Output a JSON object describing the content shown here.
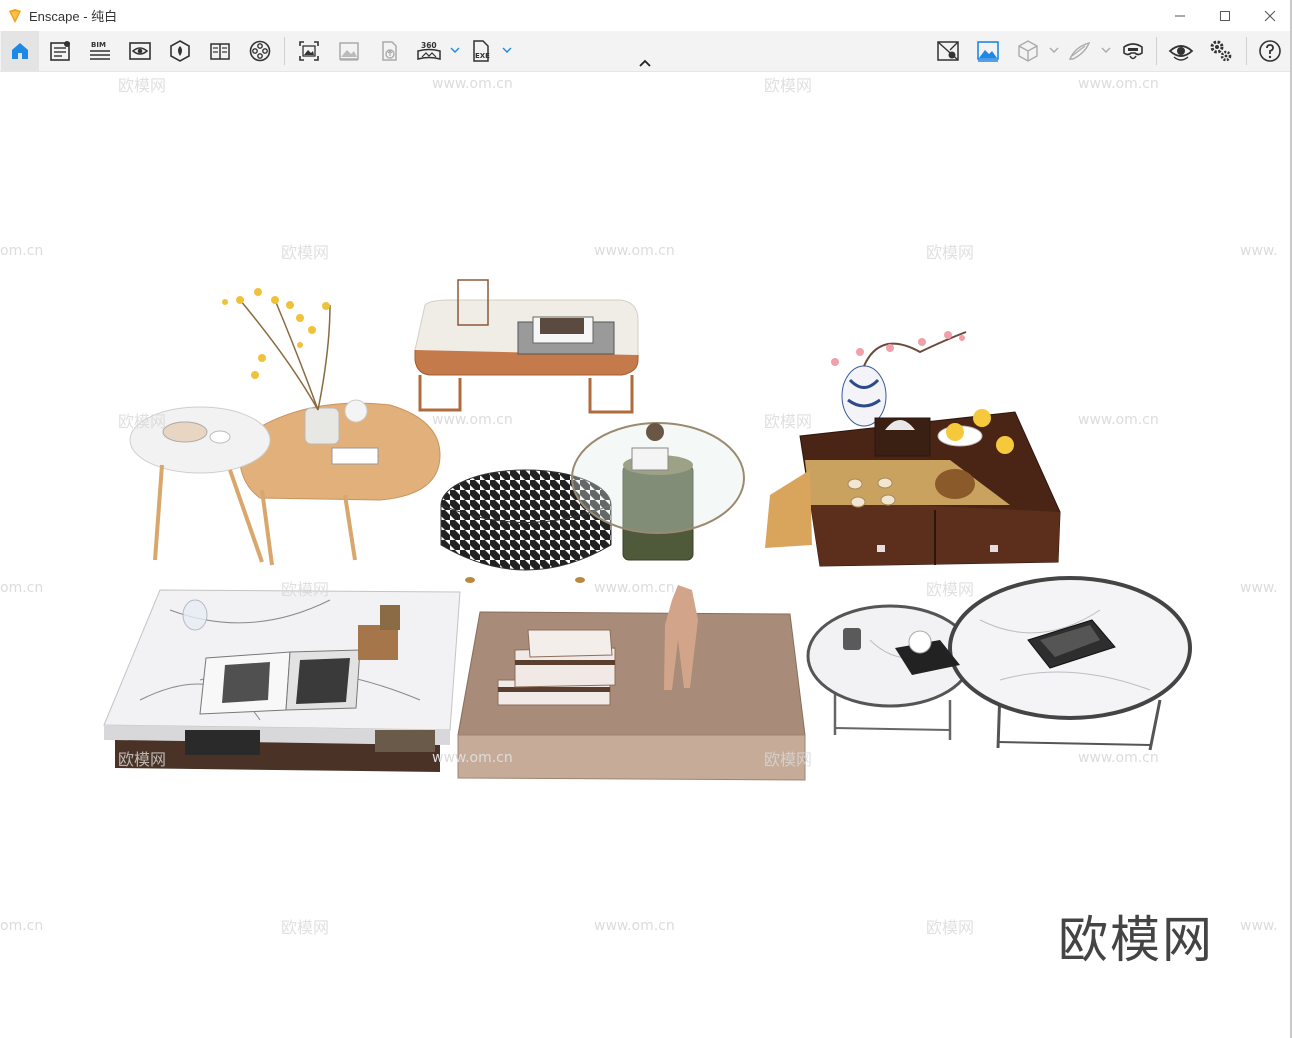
{
  "window": {
    "title": "Enscape - 纯白",
    "minimize_glyph": "—",
    "maximize_glyph": "☐",
    "close_glyph": "✕"
  },
  "toolbar": {
    "left_items": [
      {
        "name": "home-icon",
        "label": "Home"
      },
      {
        "name": "project-info-icon",
        "label": "Project"
      },
      {
        "name": "bim-icon",
        "label": "BIM"
      },
      {
        "name": "views-icon",
        "label": "Views"
      },
      {
        "name": "asset-library-icon",
        "label": "Asset Library"
      },
      {
        "name": "material-editor-icon",
        "label": "Materials"
      },
      {
        "name": "video-editor-icon",
        "label": "Video Editor"
      },
      {
        "name": "screenshot-icon",
        "label": "Render Image"
      },
      {
        "name": "batch-render-icon",
        "label": "Batch Render"
      },
      {
        "name": "upload-icon",
        "label": "Upload"
      },
      {
        "name": "panorama-360-icon",
        "label": "360"
      },
      {
        "name": "export-exe-icon",
        "label": "EXE"
      }
    ],
    "bim_text": "BIM",
    "pano_text": "360",
    "exe_text": "EXE",
    "right_items": [
      {
        "name": "capture-manager-icon",
        "label": "Capture"
      },
      {
        "name": "image-visual-settings-icon",
        "label": "Visual Settings"
      },
      {
        "name": "cube-view-icon",
        "label": "View Mode"
      },
      {
        "name": "pen-feedback-icon",
        "label": "Feedback"
      },
      {
        "name": "vr-headset-icon",
        "label": "VR"
      },
      {
        "name": "eye-preview-icon",
        "label": "Preview"
      },
      {
        "name": "settings-gears-icon",
        "label": "Settings"
      },
      {
        "name": "help-icon",
        "label": "Help"
      }
    ]
  },
  "watermarks": {
    "brand_small": "欧模网",
    "site": "www.om.cn",
    "site_partial_left": "om.cn",
    "site_partial_right": "www.",
    "brand_large": "欧模网"
  },
  "colors": {
    "accent_blue": "#1e88e5",
    "logo_orange": "#f39c12",
    "toolbar_bg": "#f3f3f3"
  }
}
